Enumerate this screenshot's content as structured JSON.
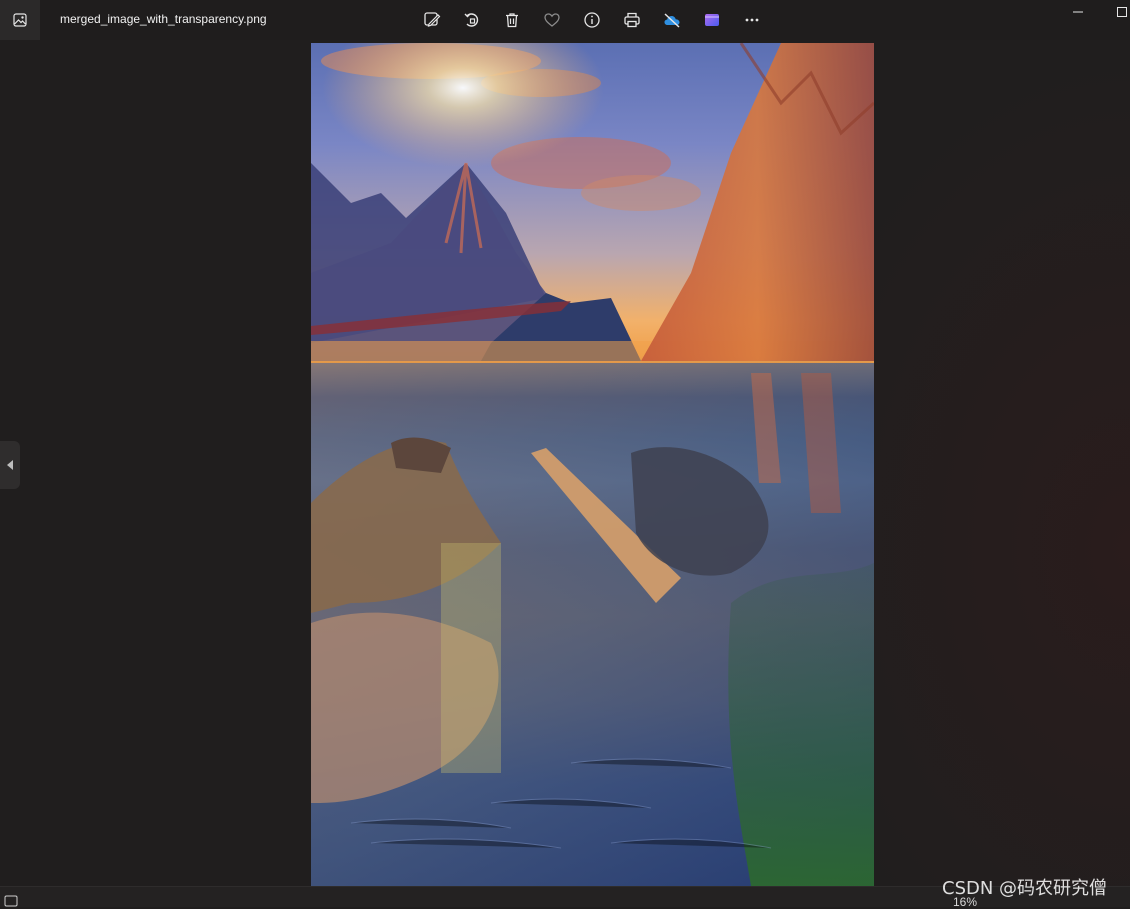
{
  "window": {
    "filename": "merged_image_with_transparency.png"
  },
  "toolbar": {
    "items": [
      {
        "name": "edit-image-button",
        "icon": "edit-image-icon"
      },
      {
        "name": "rotate-button",
        "icon": "rotate-icon"
      },
      {
        "name": "delete-button",
        "icon": "trash-icon"
      },
      {
        "name": "favorite-button",
        "icon": "heart-icon"
      },
      {
        "name": "file-info-button",
        "icon": "info-icon"
      },
      {
        "name": "print-button",
        "icon": "printer-icon"
      },
      {
        "name": "onedrive-button",
        "icon": "cloud-off-icon"
      },
      {
        "name": "clipchamp-button",
        "icon": "clipchamp-icon"
      },
      {
        "name": "more-options-button",
        "icon": "ellipsis-icon"
      }
    ]
  },
  "status": {
    "zoom": "16%"
  },
  "watermark": {
    "text": "CSDN @码农研究僧"
  },
  "colors": {
    "background": "#201e1e",
    "titlebar": "#1f1d1d",
    "accent_onedrive": "#2f8fe0",
    "accent_clipchamp": "#7b5cf0"
  }
}
